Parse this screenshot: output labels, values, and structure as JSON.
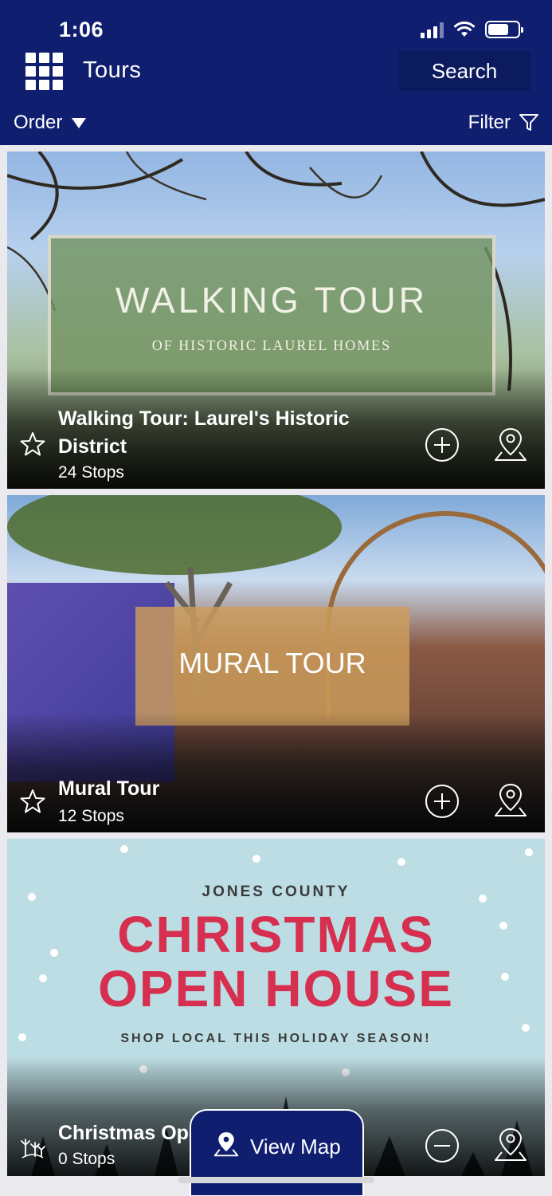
{
  "status_bar": {
    "time": "1:06"
  },
  "header": {
    "title": "Tours",
    "search_label": "Search",
    "order_label": "Order",
    "filter_label": "Filter",
    "color": "#0f1e6f"
  },
  "tours": [
    {
      "image_text": {
        "main": "WALKING TOUR",
        "sub": "OF HISTORIC LAUREL HOMES"
      },
      "title": "Walking Tour: Laurel's Historic District",
      "stops": "24 Stops",
      "favorite_icon": "star-outline-icon",
      "action_icon": "plus-circle-icon"
    },
    {
      "image_text": {
        "main": "MURAL TOUR"
      },
      "title": "Mural Tour",
      "stops": "12 Stops",
      "favorite_icon": "star-outline-icon",
      "action_icon": "plus-circle-icon"
    },
    {
      "image_text": {
        "top": "JONES COUNTY",
        "line1": "CHRISTMAS",
        "line2": "OPEN HOUSE",
        "bottom": "SHOP LOCAL THIS HOLIDAY SEASON!"
      },
      "title": "Christmas Op",
      "stops": "0 Stops",
      "favorite_icon": "fireworks-icon",
      "action_icon": "minus-circle-icon"
    }
  ],
  "view_map": {
    "label": "View Map"
  }
}
